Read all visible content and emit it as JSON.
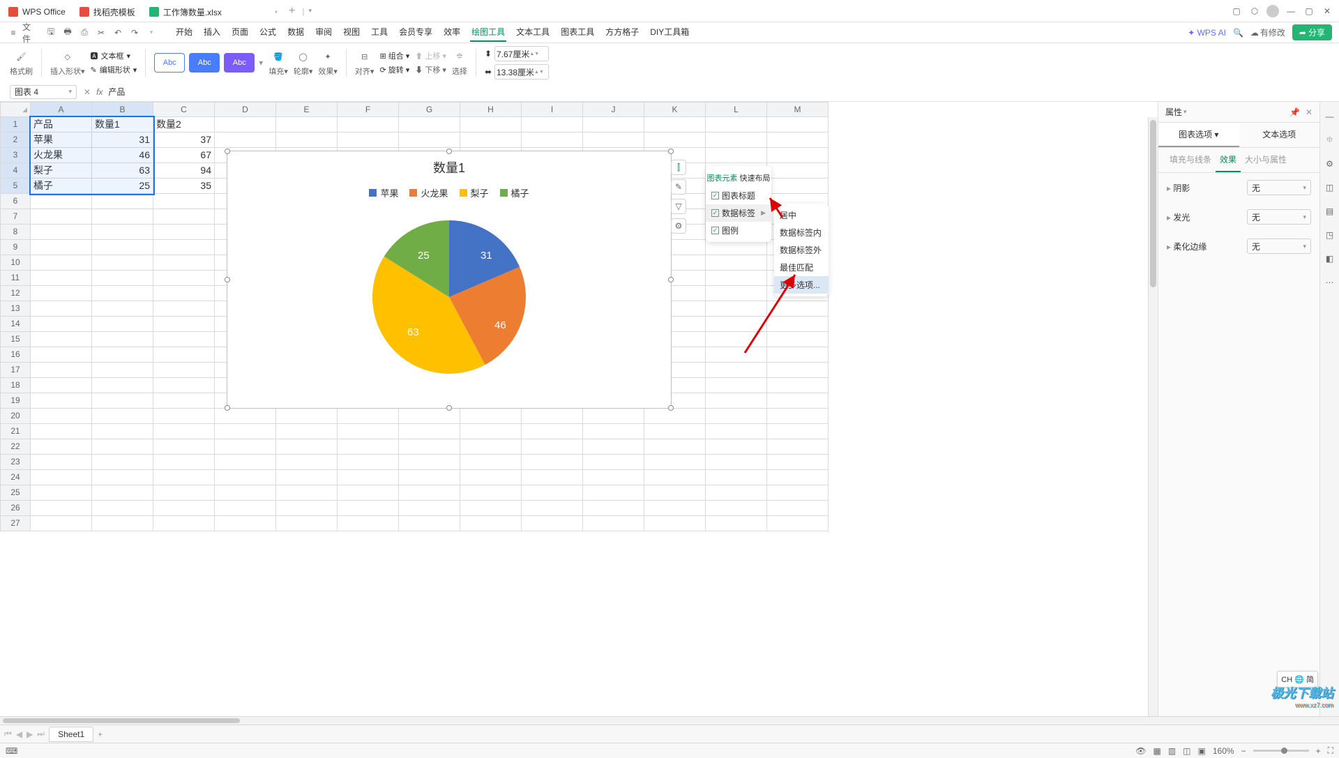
{
  "titlebar": {
    "tab1": "WPS Office",
    "tab2": "找稻壳模板",
    "tab3": "工作簿数量.xlsx"
  },
  "menubar": {
    "file": "文件",
    "tabs": [
      "开始",
      "插入",
      "页面",
      "公式",
      "数据",
      "审阅",
      "视图",
      "工具",
      "会员专享",
      "效率",
      "绘图工具",
      "文本工具",
      "图表工具",
      "方方格子",
      "DIY工具箱"
    ],
    "active": 10,
    "wpsa": "WPS AI",
    "modify": "有修改",
    "share": "分享"
  },
  "ribbon": {
    "g1": "格式刷",
    "g2": "插入形状",
    "g3": "文本框",
    "g4": "编辑形状",
    "abc": "Abc",
    "fill": "填充",
    "outline": "轮廓",
    "effect": "效果",
    "align": "对齐",
    "group": "组合",
    "rotate": "旋转",
    "up": "上移",
    "down": "下移",
    "select": "选择",
    "w": "7.67厘米",
    "h": "13.38厘米"
  },
  "refbar": {
    "name": "图表 4",
    "fx": "产品"
  },
  "cols": [
    "A",
    "B",
    "C",
    "D",
    "E",
    "F",
    "G",
    "H",
    "I",
    "J",
    "K",
    "L",
    "M"
  ],
  "rows": 27,
  "table": {
    "headers": [
      "产品",
      "数量1",
      "数量2"
    ],
    "r1": [
      "苹果",
      "31",
      "37"
    ],
    "r2": [
      "火龙果",
      "46",
      "67"
    ],
    "r3": [
      "梨子",
      "63",
      "94"
    ],
    "r4": [
      "橘子",
      "25",
      "35"
    ]
  },
  "chart": {
    "title": "数量1",
    "legend": [
      "苹果",
      "火龙果",
      "梨子",
      "橘子"
    ],
    "colors": [
      "#4472c4",
      "#ed7d31",
      "#ffc000",
      "#70ad47"
    ],
    "labels": [
      "31",
      "46",
      "63",
      "25"
    ]
  },
  "chart_data": {
    "type": "pie",
    "title": "数量1",
    "categories": [
      "苹果",
      "火龙果",
      "梨子",
      "橘子"
    ],
    "values": [
      31,
      46,
      63,
      25
    ],
    "colors": [
      "#4472c4",
      "#ed7d31",
      "#ffc000",
      "#70ad47"
    ],
    "labels_position": "inside"
  },
  "popup1": {
    "tab1": "图表元素",
    "tab2": "快速布局",
    "r1": "图表标题",
    "r2": "数据标签",
    "r3": "图例"
  },
  "popup2": {
    "r1": "居中",
    "r2": "数据标签内",
    "r3": "数据标签外",
    "r4": "最佳匹配",
    "r5": "更多选项..."
  },
  "prop": {
    "title": "属性",
    "tab1": "图表选项",
    "tab2": "文本选项",
    "sub1": "填充与线条",
    "sub2": "效果",
    "sub3": "大小与属性",
    "row1": "阴影",
    "row2": "发光",
    "row3": "柔化边缘",
    "none": "无"
  },
  "sheettab": "Sheet1",
  "statusbar": {
    "zoom": "160%"
  },
  "ime": "CH 🌐 简",
  "watermark": {
    "t": "极光下载站",
    "u": "www.xz7.com"
  }
}
